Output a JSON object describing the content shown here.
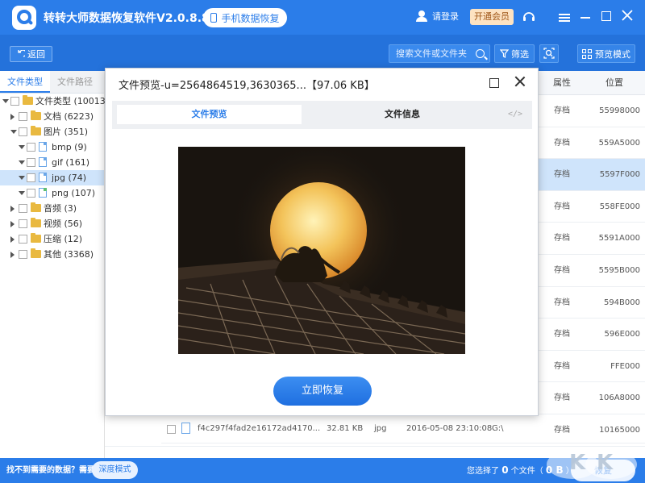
{
  "app": {
    "title": "转转大师数据恢复软件V2.0.8.8",
    "mobile_button": "手机数据恢复",
    "login": "请登录",
    "vip_button": "开通会员"
  },
  "toolbar": {
    "back": "返回",
    "search_placeholder": "搜索文件或文件夹",
    "filter": "筛选",
    "preview_mode": "预览模式"
  },
  "left_panel": {
    "tabs": [
      "文件类型",
      "文件路径"
    ],
    "tree": [
      {
        "label": "文件类型 (10013)",
        "level": 0,
        "kind": "folder",
        "expanded": true
      },
      {
        "label": "文档 (6223)",
        "level": 1,
        "kind": "folder",
        "expanded": false
      },
      {
        "label": "图片 (351)",
        "level": 1,
        "kind": "folder",
        "expanded": true
      },
      {
        "label": "bmp (9)",
        "level": 2,
        "kind": "file",
        "expanded": true
      },
      {
        "label": "gif (161)",
        "level": 2,
        "kind": "file",
        "expanded": true
      },
      {
        "label": "jpg (74)",
        "level": 2,
        "kind": "file",
        "expanded": true,
        "selected": true
      },
      {
        "label": "png (107)",
        "level": 2,
        "kind": "file-png",
        "expanded": true
      },
      {
        "label": "音频 (3)",
        "level": 1,
        "kind": "folder",
        "expanded": false
      },
      {
        "label": "视频 (56)",
        "level": 1,
        "kind": "folder",
        "expanded": false
      },
      {
        "label": "压缩 (12)",
        "level": 1,
        "kind": "folder",
        "expanded": false
      },
      {
        "label": "其他 (3368)",
        "level": 1,
        "kind": "folder",
        "expanded": false
      }
    ]
  },
  "file_list": {
    "headers": {
      "attr": "属性",
      "location": "位置"
    },
    "rows": [
      {
        "attr": "存档",
        "location": "55998000"
      },
      {
        "attr": "存档",
        "location": "559A5000"
      },
      {
        "attr": "存档",
        "location": "5597F000",
        "selected": true
      },
      {
        "attr": "存档",
        "location": "558FE000"
      },
      {
        "attr": "存档",
        "location": "5591A000"
      },
      {
        "attr": "存档",
        "location": "5595B000"
      },
      {
        "attr": "存档",
        "location": "594B000"
      },
      {
        "attr": "存档",
        "location": "596E000"
      },
      {
        "attr": "存档",
        "location": "FFE000"
      },
      {
        "attr": "存档",
        "location": "106A8000"
      },
      {
        "attr": "存档",
        "location": "10165000"
      }
    ],
    "last_row": {
      "name": "f4c297f4fad2e16172ad4170...",
      "size": "32.81 KB",
      "type": "jpg",
      "date": "2016-05-08 23:10:08",
      "path": "G:\\"
    }
  },
  "dialog": {
    "title": "文件预览-u=2564864519,3630365...【97.06 KB】",
    "tabs": {
      "preview": "文件预览",
      "info": "文件信息"
    },
    "code_icon": "</>",
    "restore_button": "立即恢复"
  },
  "bottom": {
    "hint": "找不到需要的数据？需要",
    "deep_mode": "深度模式",
    "status_prefix": "您选择了",
    "file_count": "0",
    "status_mid": "个文件（",
    "size": "0 B",
    "status_suffix": "）",
    "recover": "恢复"
  },
  "colors": {
    "brand_blue": "#2b7de9",
    "toolbar_blue": "#2472db",
    "vip_bg": "#fde3c2",
    "selection": "#cfe4fb"
  }
}
